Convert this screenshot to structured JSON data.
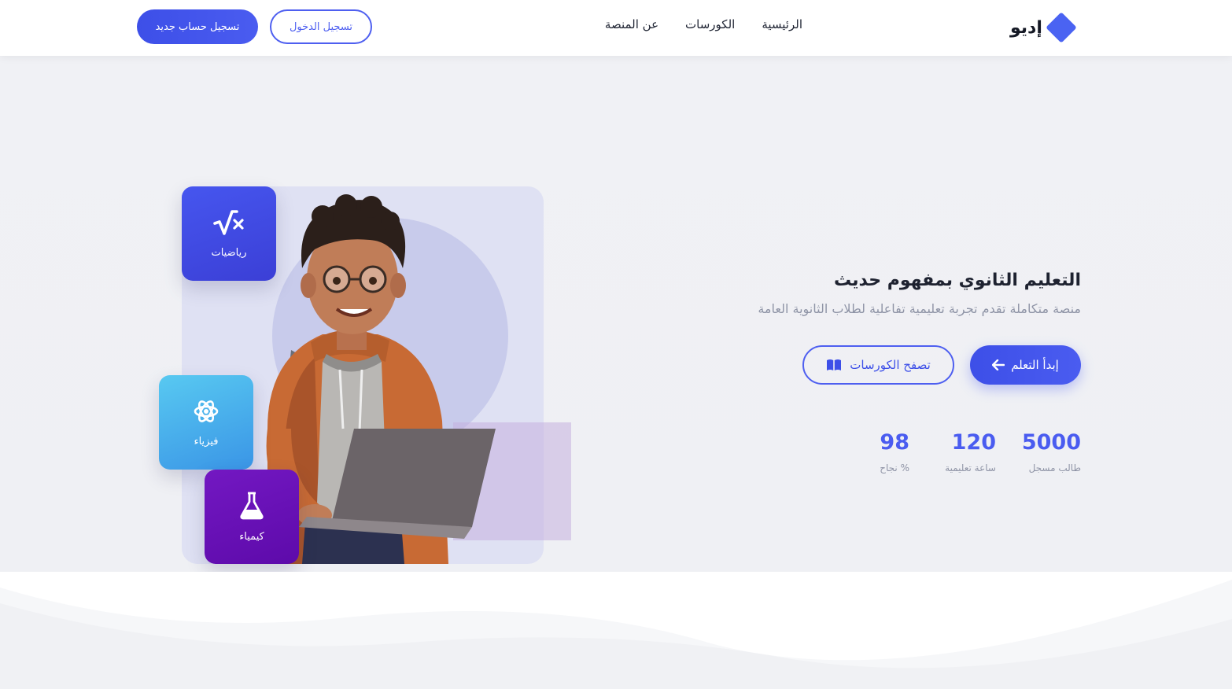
{
  "header": {
    "logo_text": "إديو",
    "nav": [
      "الرئيسية",
      "الكورسات",
      "عن المنصة"
    ],
    "login_label": "تسجيل الدخول",
    "signup_label": "تسجيل حساب جديد"
  },
  "hero": {
    "title": "التعليم الثانوي بمفهوم حديث",
    "subtitle": "منصة متكاملة تقدم تجربة تعليمية تفاعلية لطلاب الثانوية العامة",
    "start_label": "إبدأ التعلم",
    "browse_label": "تصفح الكورسات",
    "stats": [
      {
        "value": "5000",
        "label": "طالب مسجل"
      },
      {
        "value": "120",
        "label": "ساعة تعليمية"
      },
      {
        "value": "98",
        "label": "% نجاح"
      }
    ]
  },
  "subjects": [
    {
      "label": "رياضيات",
      "icon": "square-root-icon"
    },
    {
      "label": "فيزياء",
      "icon": "atom-icon"
    },
    {
      "label": "كيمياء",
      "icon": "flask-icon"
    }
  ],
  "colors": {
    "primary": "#4a5cf0",
    "math_tile": "#4656ef",
    "physics_tile": "#58c9f1",
    "chemistry_tile": "#6a10b8"
  }
}
